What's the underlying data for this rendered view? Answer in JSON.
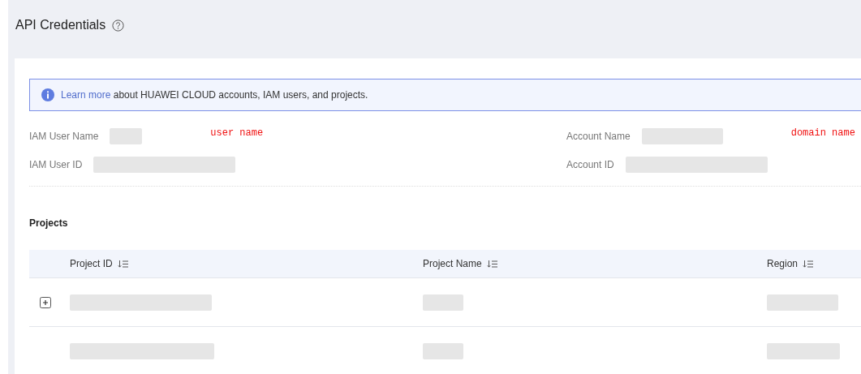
{
  "page": {
    "title": "API Credentials"
  },
  "notice": {
    "link": "Learn more",
    "text": "about HUAWEI CLOUD accounts, IAM users, and projects."
  },
  "fields": [
    {
      "label": "IAM User Name",
      "note": "user name"
    },
    {
      "label": "Account Name",
      "note": "domain name"
    },
    {
      "label": "IAM User ID"
    },
    {
      "label": "Account ID"
    }
  ],
  "projects": {
    "title": "Projects",
    "columns": [
      "Project ID",
      "Project Name",
      "Region"
    ],
    "rows": [
      {
        "expandable": true
      },
      {
        "expandable": false
      }
    ]
  }
}
